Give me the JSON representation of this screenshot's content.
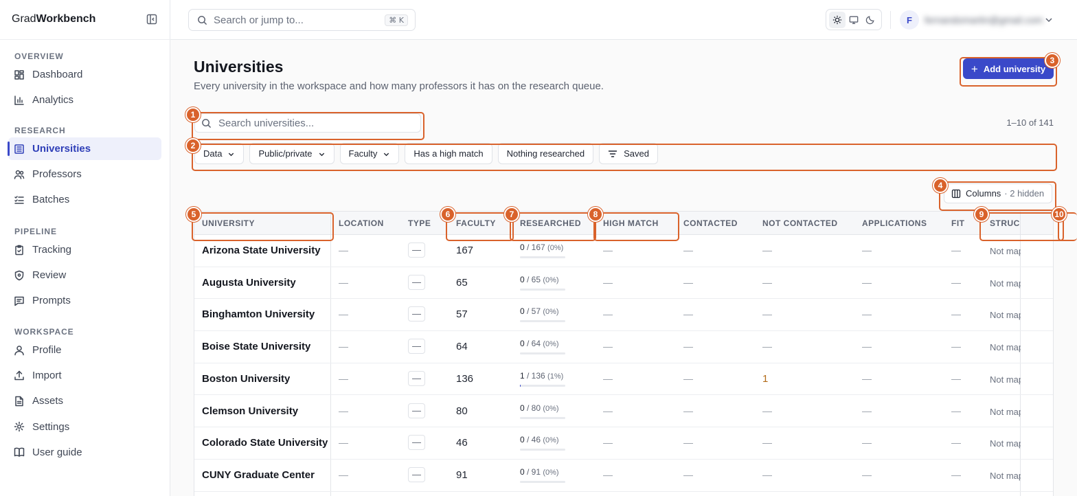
{
  "brand": {
    "prefix": "Grad",
    "suffix": "Workbench"
  },
  "sidebar": {
    "sections": [
      {
        "label": "OVERVIEW",
        "items": [
          {
            "label": "Dashboard",
            "icon": "dashboard-icon"
          },
          {
            "label": "Analytics",
            "icon": "bar-chart-icon"
          }
        ]
      },
      {
        "label": "RESEARCH",
        "items": [
          {
            "label": "Universities",
            "icon": "building-icon",
            "active": true
          },
          {
            "label": "Professors",
            "icon": "users-icon"
          },
          {
            "label": "Batches",
            "icon": "list-checks-icon"
          }
        ]
      },
      {
        "label": "PIPELINE",
        "items": [
          {
            "label": "Tracking",
            "icon": "clipboard-icon"
          },
          {
            "label": "Review",
            "icon": "shield-icon"
          },
          {
            "label": "Prompts",
            "icon": "message-icon"
          }
        ]
      },
      {
        "label": "WORKSPACE",
        "items": [
          {
            "label": "Profile",
            "icon": "user-icon"
          },
          {
            "label": "Import",
            "icon": "upload-icon"
          },
          {
            "label": "Assets",
            "icon": "file-icon"
          },
          {
            "label": "Settings",
            "icon": "gear-icon"
          },
          {
            "label": "User guide",
            "icon": "book-icon"
          }
        ]
      }
    ]
  },
  "topbar": {
    "search_placeholder": "Search or jump to...",
    "shortcut": "⌘ K",
    "theme_modes": [
      "light",
      "system",
      "dark"
    ],
    "active_theme": "light",
    "avatar_initial": "F",
    "account_name": "fernandomartin@gmail.com"
  },
  "main": {
    "title": "Universities",
    "subtitle": "Every university in the workspace and how many professors it has on the research queue.",
    "add_button": "Add university",
    "search_placeholder": "Search universities...",
    "range_count": "1–10 of 141",
    "filters": [
      {
        "label": "Data",
        "dropdown": true
      },
      {
        "label": "Public/private",
        "dropdown": true
      },
      {
        "label": "Faculty",
        "dropdown": true
      },
      {
        "label": "Has a high match",
        "dropdown": false
      },
      {
        "label": "Nothing researched",
        "dropdown": false
      },
      {
        "label": "Saved",
        "dropdown": false,
        "icon": "filter-icon"
      }
    ],
    "columns_button": {
      "label": "Columns",
      "hidden": "· 2 hidden"
    }
  },
  "table": {
    "columns": [
      "UNIVERSITY",
      "LOCATION",
      "TYPE",
      "FACULTY",
      "RESEARCHED",
      "HIGH MATCH",
      "CONTACTED",
      "NOT CONTACTED",
      "APPLICATIONS",
      "FIT",
      "STRUC"
    ],
    "rows": [
      {
        "name": "Arizona State University",
        "location": "—",
        "type": "—",
        "faculty": "167",
        "researched": "0",
        "total": "/ 167",
        "pct": "(0%)",
        "fraction": 0,
        "high_match": "—",
        "contacted": "—",
        "not_contacted": "—",
        "applications": "—",
        "fit": "—",
        "structure": "Not mapped"
      },
      {
        "name": "Augusta University",
        "location": "—",
        "type": "—",
        "faculty": "65",
        "researched": "0",
        "total": "/ 65",
        "pct": "(0%)",
        "fraction": 0,
        "high_match": "—",
        "contacted": "—",
        "not_contacted": "—",
        "applications": "—",
        "fit": "—",
        "structure": "Not mapped"
      },
      {
        "name": "Binghamton University",
        "location": "—",
        "type": "—",
        "faculty": "57",
        "researched": "0",
        "total": "/ 57",
        "pct": "(0%)",
        "fraction": 0,
        "high_match": "—",
        "contacted": "—",
        "not_contacted": "—",
        "applications": "—",
        "fit": "—",
        "structure": "Not mapped"
      },
      {
        "name": "Boise State University",
        "location": "—",
        "type": "—",
        "faculty": "64",
        "researched": "0",
        "total": "/ 64",
        "pct": "(0%)",
        "fraction": 0,
        "high_match": "—",
        "contacted": "—",
        "not_contacted": "—",
        "applications": "—",
        "fit": "—",
        "structure": "Not mapped"
      },
      {
        "name": "Boston University",
        "location": "—",
        "type": "—",
        "faculty": "136",
        "researched": "1",
        "total": "/ 136",
        "pct": "(1%)",
        "fraction": 0.01,
        "high_match": "—",
        "contacted": "—",
        "not_contacted": "1",
        "applications": "—",
        "fit": "—",
        "structure": "Not mapped"
      },
      {
        "name": "Clemson University",
        "location": "—",
        "type": "—",
        "faculty": "80",
        "researched": "0",
        "total": "/ 80",
        "pct": "(0%)",
        "fraction": 0,
        "high_match": "—",
        "contacted": "—",
        "not_contacted": "—",
        "applications": "—",
        "fit": "—",
        "structure": "Not mapped"
      },
      {
        "name": "Colorado State University",
        "location": "—",
        "type": "—",
        "faculty": "46",
        "researched": "0",
        "total": "/ 46",
        "pct": "(0%)",
        "fraction": 0,
        "high_match": "—",
        "contacted": "—",
        "not_contacted": "—",
        "applications": "—",
        "fit": "—",
        "structure": "Not mapped"
      },
      {
        "name": "CUNY Graduate Center",
        "location": "—",
        "type": "—",
        "faculty": "91",
        "researched": "0",
        "total": "/ 91",
        "pct": "(0%)",
        "fraction": 0,
        "high_match": "—",
        "contacted": "—",
        "not_contacted": "—",
        "applications": "—",
        "fit": "—",
        "structure": "Not mapped"
      }
    ]
  },
  "annotations": [
    "1",
    "2",
    "3",
    "4",
    "5",
    "6",
    "7",
    "8",
    "9",
    "10"
  ],
  "colors": {
    "accent": "#3a49c9",
    "annotation": "#d9622b",
    "highlight_value": "#b26a18"
  }
}
